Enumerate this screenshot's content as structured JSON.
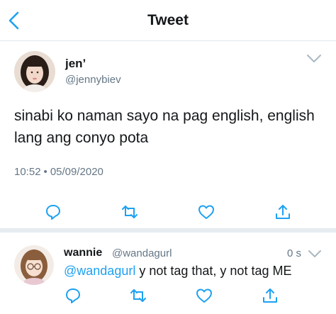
{
  "header": {
    "title": "Tweet"
  },
  "tweet": {
    "name": "jen’",
    "handle": "@jennybiev",
    "text": "sinabi ko naman sayo na pag english, english lang ang conyo pota",
    "time": "10:52",
    "separator": "•",
    "date": "05/09/2020"
  },
  "reply": {
    "name": "wannie",
    "handle": "@wandagurl",
    "time": "0 s",
    "mention": "@wandagurl",
    "text": " y not tag that, y not tag ME"
  },
  "icons": {
    "back": "chevron-left-icon",
    "more": "chevron-down-icon",
    "reply": "reply-icon",
    "retweet": "retweet-icon",
    "like": "heart-icon",
    "share": "share-icon"
  },
  "colors": {
    "accent": "#1da1f2",
    "text": "#14171a",
    "secondary": "#657786",
    "action_icon": "#1da1f2"
  }
}
